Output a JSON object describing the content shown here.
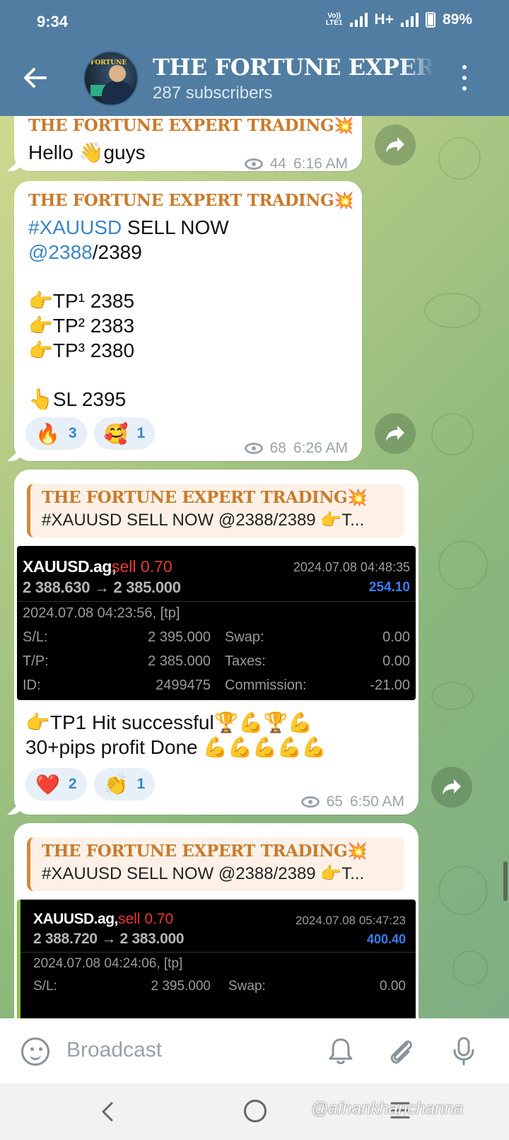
{
  "status_bar": {
    "time": "9:34",
    "network": "H+",
    "battery": "89%",
    "lte_label": "Vo)) LTE1"
  },
  "header": {
    "title": "THE FORTUNE EXPERT TRADING",
    "subtitle": "287 subscribers",
    "avatar_text": "FORTUNE EXPERT TRADING"
  },
  "messages": [
    {
      "sender": "THE FORTUNE EXPERT TRADING",
      "spark": "💥",
      "text": "Hello 👋guys",
      "views": "44",
      "time": "6:16 AM"
    },
    {
      "sender": "THE FORTUNE EXPERT TRADING",
      "spark": "💥",
      "hashtag": "#XAUUSD",
      "line1_rest": " SELL NOW",
      "mention": "@2388",
      "line2_rest": "/2389",
      "tp1": "👉TP¹ 2385",
      "tp2": "👉TP² 2383",
      "tp3": "👉TP³ 2380",
      "sl": "👆SL 2395",
      "reactions": [
        {
          "emoji": "🔥",
          "count": "3"
        },
        {
          "emoji": "🥰",
          "count": "1"
        }
      ],
      "views": "68",
      "time": "6:26 AM"
    },
    {
      "reply_sender": "THE FORTUNE EXPERT TRADING",
      "reply_spark": "💥",
      "reply_text": "#XAUUSD SELL NOW @2388/2389 👉T...",
      "trade": {
        "symbol": "XAUUSD.ag,",
        "side": "sell 0.70",
        "close_date": "2024.07.08 04:48:35",
        "prices": "2 388.630 → 2 385.000",
        "profit": "254.10",
        "open_date": "2024.07.08 04:23:56, [tp]",
        "sl_label": "S/L:",
        "sl_value": "2 395.000",
        "swap_label": "Swap:",
        "swap_value": "0.00",
        "tp_label": "T/P:",
        "tp_value": "2 385.000",
        "taxes_label": "Taxes:",
        "taxes_value": "0.00",
        "id_label": "ID:",
        "id_value": "2499475",
        "commission_label": "Commission:",
        "commission_value": "-21.00"
      },
      "line1": "👉TP1  Hit successful🏆💪🏆💪",
      "line2": "30+pips profit Done 💪💪💪💪💪",
      "reactions": [
        {
          "emoji": "❤️",
          "count": "2"
        },
        {
          "emoji": "👏",
          "count": "1"
        }
      ],
      "views": "65",
      "time": "6:50 AM"
    },
    {
      "reply_sender": "THE FORTUNE EXPERT TRADING",
      "reply_spark": "💥",
      "reply_text": "#XAUUSD SELL NOW @2388/2389 👉T...",
      "trade": {
        "symbol": "XAUUSD.ag,",
        "side": "sell 0.70",
        "close_date": "2024.07.08 05:47:23",
        "prices": "2 388.720 → 2 383.000",
        "profit": "400.40",
        "open_date": "2024.07.08 04:24:06, [tp]",
        "sl_label": "S/L:",
        "sl_value": "2 395.000",
        "swap_label": "Swap:",
        "swap_value": "0.00"
      }
    }
  ],
  "input": {
    "placeholder": "Broadcast"
  },
  "watermark": "@afnankhanchanna",
  "colors": {
    "header": "#517da2",
    "sender": "#c97b2c",
    "link": "#3b85c5",
    "sell": "#e53935",
    "profit": "#3a7ef0"
  }
}
